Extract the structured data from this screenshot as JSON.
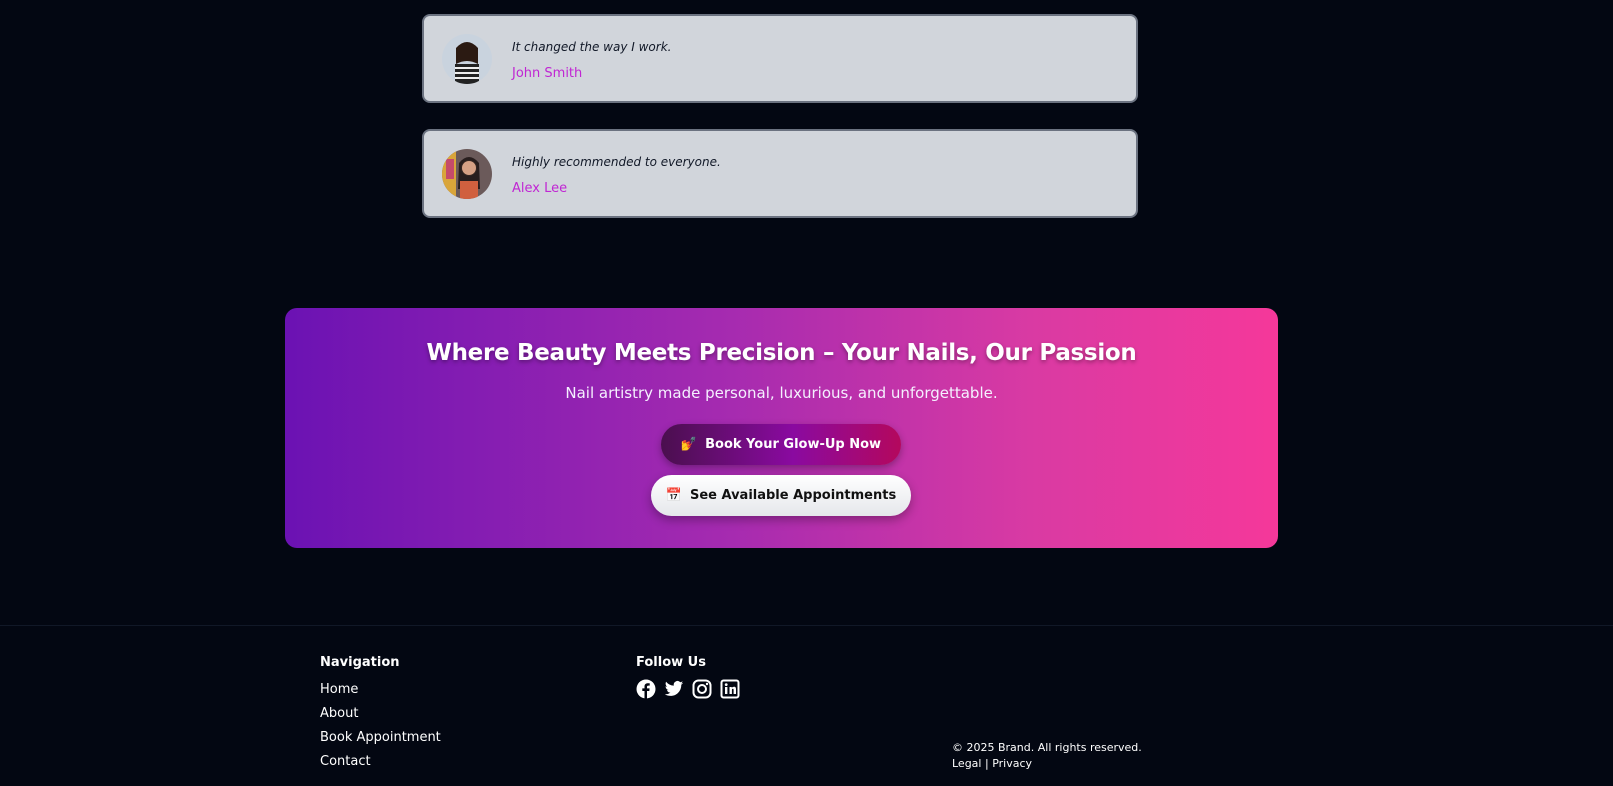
{
  "testimonials": [
    {
      "quote": "It changed the way I work.",
      "author": "John Smith"
    },
    {
      "quote": "Highly recommended to everyone.",
      "author": "Alex Lee"
    }
  ],
  "cta": {
    "title": "Where Beauty Meets Precision – Your Nails, Our Passion",
    "subtitle": "Nail artistry made personal, luxurious, and unforgettable.",
    "primary_button": {
      "icon": "💅",
      "label": "Book Your Glow-Up Now"
    },
    "secondary_button": {
      "icon": "📅",
      "label": "See Available Appointments"
    }
  },
  "footer": {
    "navigation": {
      "title": "Navigation",
      "links": [
        "Home",
        "About",
        "Book Appointment",
        "Contact"
      ]
    },
    "follow": {
      "title": "Follow Us",
      "icons": [
        "facebook-icon",
        "twitter-icon",
        "instagram-icon",
        "linkedin-icon"
      ]
    },
    "copyright": "© 2025 Brand. All rights reserved.",
    "legal": {
      "legal_label": "Legal",
      "separator": "|",
      "privacy_label": "Privacy"
    }
  },
  "colors": {
    "background": "#030712",
    "card": "#d1d5db",
    "accent": "#c026d3",
    "cta_start": "#6b12b3",
    "cta_end": "#f5389a"
  }
}
